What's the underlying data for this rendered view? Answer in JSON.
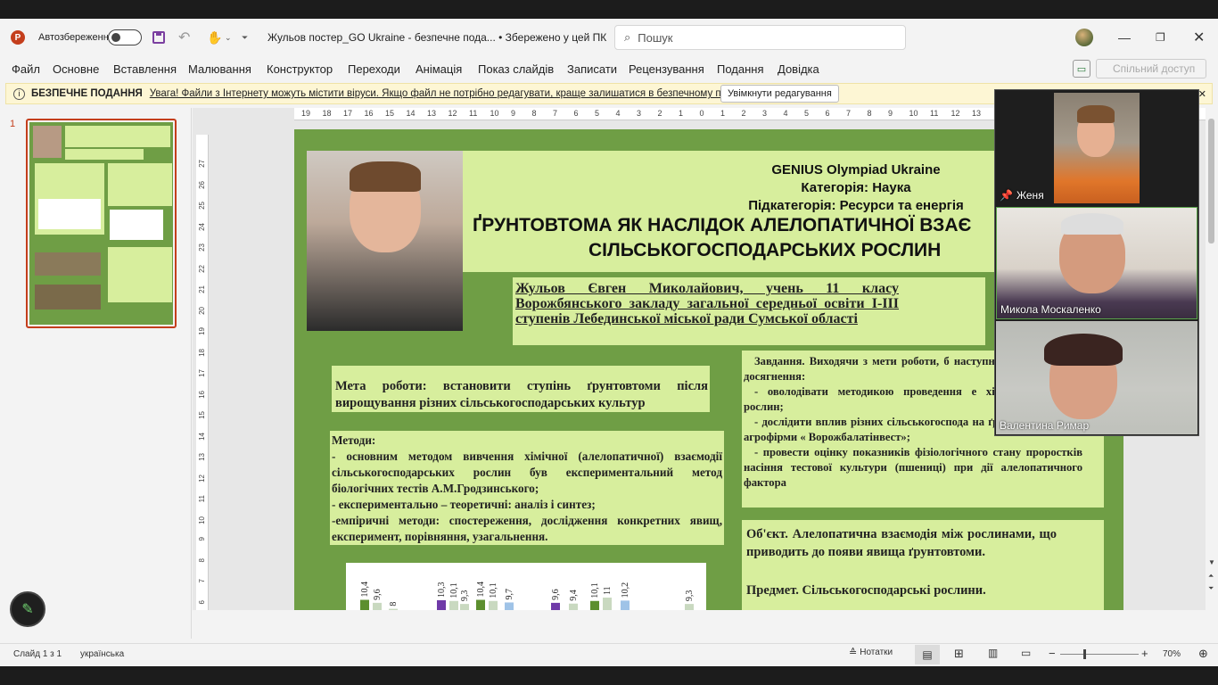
{
  "window": {
    "autosave_label": "Автозбереження",
    "doc_title": "Жульов постер_GO Ukraine  -  безпечне пода...  •  Збережено у цей ПК",
    "search_placeholder": "Пошук"
  },
  "menu": [
    "Файл",
    "Основне",
    "Вставлення",
    "Малювання",
    "Конструктор",
    "Переходи",
    "Анімація",
    "Показ слайдів",
    "Записати",
    "Рецензування",
    "Подання",
    "Довідка"
  ],
  "share_label": "Спільний доступ",
  "security_bar": {
    "title": "БЕЗПЕЧНЕ ПОДАННЯ",
    "message": "Увага! Файли з Інтернету можуть містити віруси. Якщо файл не потрібно редагувати, краще залишатися в безпечному поданні.",
    "button": "Увімкнути редагування"
  },
  "thumb_number": "1",
  "ruler_h": [
    "19",
    "18",
    "17",
    "16",
    "15",
    "14",
    "13",
    "12",
    "11",
    "10",
    "9",
    "8",
    "7",
    "6",
    "5",
    "4",
    "3",
    "2",
    "1",
    "0",
    "1",
    "2",
    "3",
    "4",
    "5",
    "6",
    "7",
    "8",
    "9",
    "10",
    "11",
    "12",
    "13"
  ],
  "ruler_v": [
    "27",
    "26",
    "25",
    "24",
    "23",
    "22",
    "21",
    "20",
    "19",
    "18",
    "17",
    "16",
    "15",
    "14",
    "13",
    "12",
    "11",
    "10",
    "9",
    "8",
    "7",
    "6"
  ],
  "slide": {
    "header_lines": [
      "GENIUS Olympiad Ukraine",
      "Категорія: Наука",
      "Підкатегорія: Ресурси та енергія"
    ],
    "title_line1": "ҐРУНТОВТОМА ЯК НАСЛІДОК  АЛЕЛОПАТИЧНОЇ ВЗАЄ",
    "title_line2": "СІЛЬСЬКОГОСПОДАРСЬКИХ РОСЛИН",
    "author": "Жульов Євген Миколайович, учень 11 класу Ворожбянського закладу загальної середньої освіти I-III ступенів Лебединської міської ради Сумської області",
    "goal": "Мета роботи: встановити ступінь ґрунтовтоми після вирощування різних сільськогосподарських культур",
    "methods_title": "Методи:",
    "methods_lines": [
      "- основним методом вивчення хімічної (алелопатичної) взаємодії сільськогосподарських рослин був експериментальний метод біологічних тестів А.М.Гродзинського;",
      "- експериментально – теоретичні: аналіз і синтез;",
      "-емпіричні методи: спостереження, дослідження конкретних явищ, експеримент, порівняння, узагальнення."
    ],
    "tasks": "Завдання. Виходячи з мети роботи, б наступні завдання для її досягнення:",
    "tasks_lines": [
      "-  оволодівати методикою проведення е хімічної взаємодії рослин;",
      "-  дослідити вплив різних сільськогоспода на ґрунтовтому полів агрофірми « Ворожбалатінвест»;",
      "-  провести оцінку показників фізіологічного стану проростків насіння тестової культури (пшениці) при дії алелопатичного фактора"
    ],
    "object": "Об'єкт.  Алелопатична  взаємодія  між рослинами, що приводить до появи явища ґрунтовтоми.",
    "subject": "Предмет. Сільськогосподарські рослини."
  },
  "chart_data": {
    "type": "bar",
    "title": "",
    "data_labels": [
      "10,4",
      "9,6",
      "8",
      "10,3",
      "10,1",
      "9,3",
      "10,4",
      "10,1",
      "9,7",
      "9,6",
      "9,4",
      "10,1",
      "11",
      "10,2",
      "9,3"
    ],
    "values": [
      10.4,
      9.6,
      8,
      10.3,
      10.1,
      9.3,
      10.4,
      10.1,
      9.7,
      9.6,
      9.4,
      10.1,
      11,
      10.2,
      9.3
    ],
    "colors": {
      "green": "#5c8f2e",
      "pattern": "#c9d9c0",
      "purple": "#6f3aa8",
      "blue": "#9fc3e7"
    }
  },
  "video": {
    "participants": [
      {
        "name": "Женя",
        "pinned": true
      },
      {
        "name": "Микола Москаленко",
        "pinned": false
      },
      {
        "name": "Валентина Римар",
        "pinned": false
      }
    ]
  },
  "status": {
    "slide_info": "Слайд 1 з 1",
    "language": "українська",
    "notes": "Нотатки",
    "zoom": "70%"
  }
}
